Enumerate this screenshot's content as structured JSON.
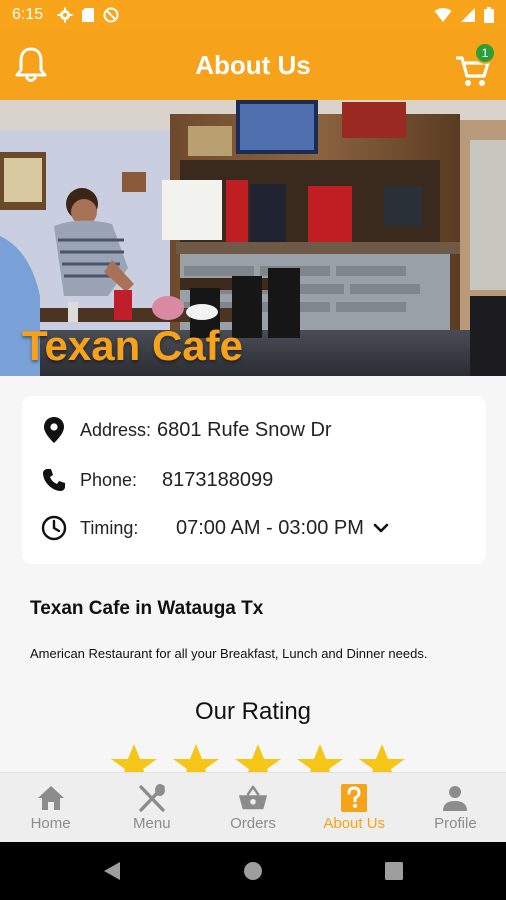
{
  "status_bar": {
    "time": "6:15"
  },
  "app_bar": {
    "title": "About Us",
    "cart_count": "1"
  },
  "hero": {
    "restaurant_name": "Texan Cafe"
  },
  "info": {
    "address_label": "Address:",
    "address_value": "6801 Rufe Snow Dr",
    "phone_label": "Phone:",
    "phone_value": "8173188099",
    "timing_label": "Timing:",
    "timing_value": "07:00 AM - 03:00 PM"
  },
  "description": {
    "title": "Texan Cafe in Watauga Tx",
    "text": "American Restaurant for all your Breakfast, Lunch and Dinner needs."
  },
  "rating": {
    "title": "Our Rating",
    "value": 5,
    "max": 5
  },
  "bottom_nav": {
    "items": [
      {
        "label": "Home",
        "icon": "home-icon"
      },
      {
        "label": "Menu",
        "icon": "utensils-icon"
      },
      {
        "label": "Orders",
        "icon": "basket-icon"
      },
      {
        "label": "About Us",
        "icon": "question-icon"
      },
      {
        "label": "Profile",
        "icon": "person-icon"
      }
    ],
    "active_index": 3
  },
  "colors": {
    "accent": "#f7a21b",
    "badge": "#2e9e3a",
    "star": "#f5c518"
  }
}
